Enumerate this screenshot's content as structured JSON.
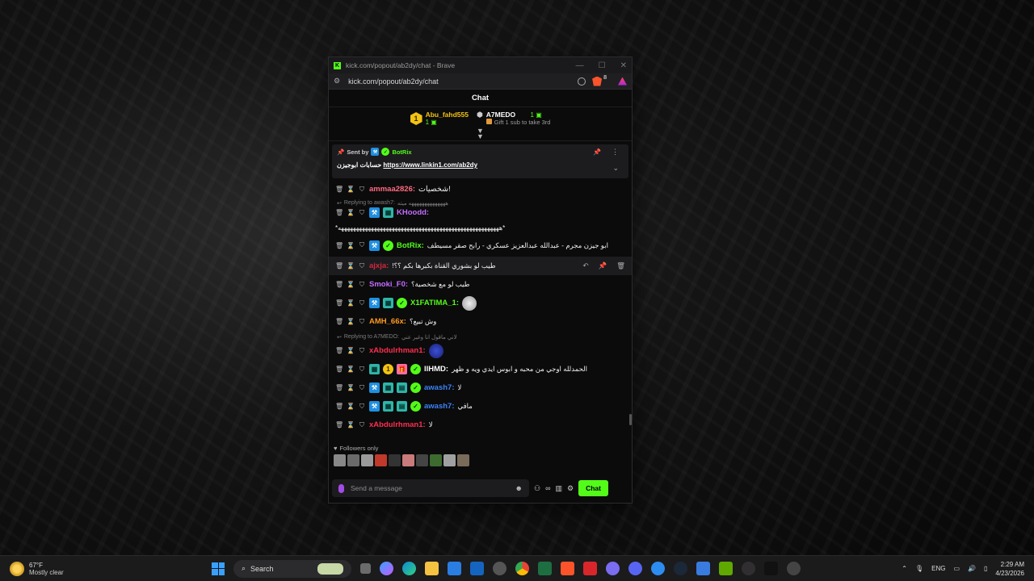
{
  "window": {
    "title": "kick.com/popout/ab2dy/chat - Brave",
    "url": "kick.com/popout/ab2dy/chat",
    "brave_badge": "8"
  },
  "chat": {
    "header": "Chat",
    "leaderboard": [
      {
        "rank": "1",
        "name": "Abu_fahd555",
        "count": "1"
      },
      {
        "rank": "",
        "name": "A7MEDO",
        "count": "1",
        "gift_text": "Gift 1 sub to take 3rd"
      }
    ],
    "pinned": {
      "sent_by_label": "Sent by",
      "author": "BotRix",
      "text": "حسابات ابوجيزن",
      "link": "https://www.linkin1.com/ab2dy"
    },
    "messages": [
      {
        "user": "ammaa2826:",
        "color": "#ff6b7e",
        "text": "شخصيات!"
      },
      {
        "reply_to": "Replying to awash7:",
        "reply_text": "ههههههههههههههه ميته"
      },
      {
        "user": "KHoodd:",
        "color": "#c46cff",
        "text": "*ههههههههههههههههههههههههههههههههههههههههههههههههههههههه*"
      },
      {
        "user": "BotRix:",
        "color": "#53fc18",
        "text": "ابو جيزن مجرم - عبدالله عبدالعزيز عسكري - رابح صقر مسيطف"
      },
      {
        "user": "ajxja:",
        "color": "#d2283c",
        "text": "!طيب لو بشوري القناة بكبرها بكم ؟؟"
      },
      {
        "user": "Smoki_F0:",
        "color": "#c46cff",
        "text": "طيب لو مع شخصية؟"
      },
      {
        "user": "X1FATIMA_1:",
        "color": "#53fc18",
        "text": ""
      },
      {
        "user": "AMH_66x:",
        "color": "#ff9a1f",
        "text": "وش تبيع؟"
      },
      {
        "reply_to": "Replying to A7MEDO:",
        "reply_text": "لاني ماقول انا وغير عني"
      },
      {
        "user": "xAbdulrhman1:",
        "color": "#ff2e4d",
        "text": ""
      },
      {
        "user": "llHMD:",
        "color": "#ffffff",
        "text": "الحمدلله اوجي من محبه و ابوس ايدي ويه و ظهر"
      },
      {
        "user": "awash7:",
        "color": "#3b82f6",
        "text": "لا"
      },
      {
        "user": "awash7:",
        "color": "#3b82f6",
        "text": "مافي"
      },
      {
        "user": "xAbdulrhman1:",
        "color": "#ff2e4d",
        "text": "لا"
      }
    ],
    "followers_only": "Followers only",
    "input_placeholder": "Send a message",
    "send_label": "Chat",
    "infinity": "∞"
  },
  "taskbar": {
    "temp": "67°F",
    "condition": "Mostly clear",
    "search": "Search",
    "lang": "ENG",
    "time": "2:29 AM",
    "date": "4/23/2026"
  }
}
